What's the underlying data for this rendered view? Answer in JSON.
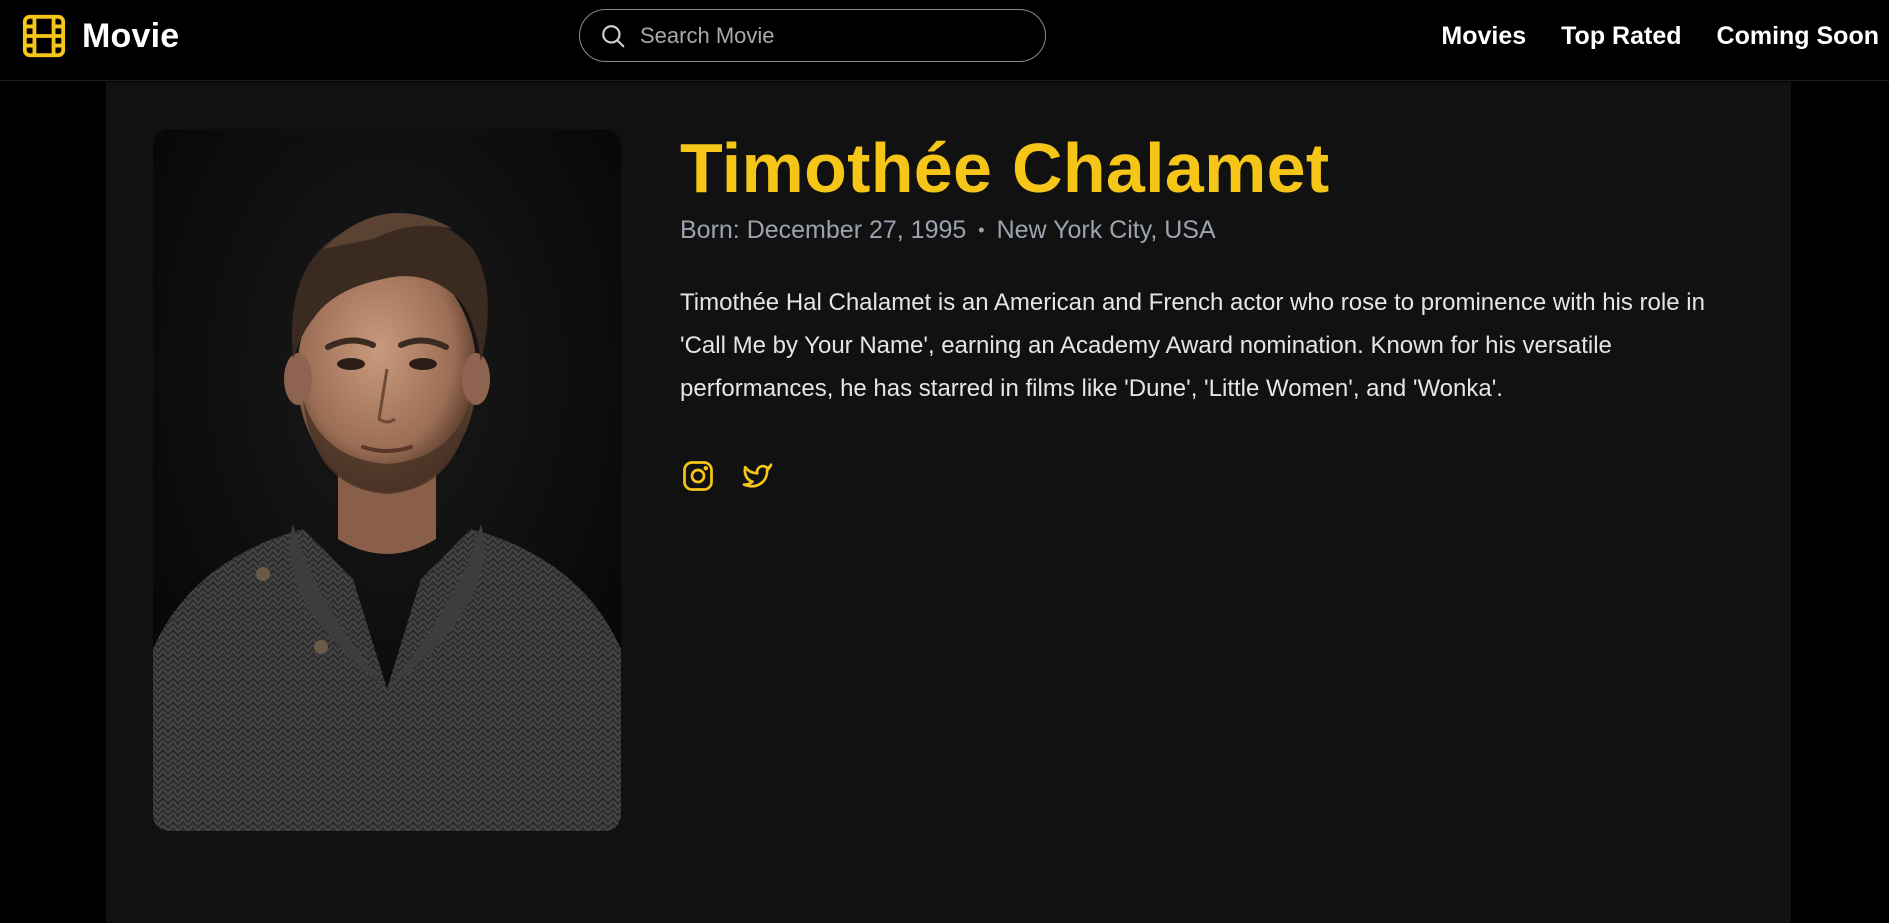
{
  "colors": {
    "accent": "#f5c518",
    "background": "#000000",
    "panel": "#111111",
    "meta_text": "#9ca3af"
  },
  "nav": {
    "brand_icon": "film-icon",
    "brand": "Movie",
    "search": {
      "icon": "search-icon",
      "placeholder": "Search Movie",
      "value": ""
    },
    "links": [
      "Movies",
      "Top Rated",
      "Coming Soon"
    ]
  },
  "profile": {
    "photo_alt": "Portrait of Timothée Chalamet",
    "name": "Timothée Chalamet",
    "born": "Born: December 27, 1995",
    "separator": "•",
    "birthplace": "New York City, USA",
    "bio": "Timothée Hal Chalamet is an American and French actor who rose to prominence with his role in 'Call Me by Your Name', earning an Academy Award nomination. Known for his versatile performances, he has starred in films like 'Dune', 'Little Women', and 'Wonka'.",
    "socials": [
      "instagram-icon",
      "twitter-icon"
    ]
  }
}
